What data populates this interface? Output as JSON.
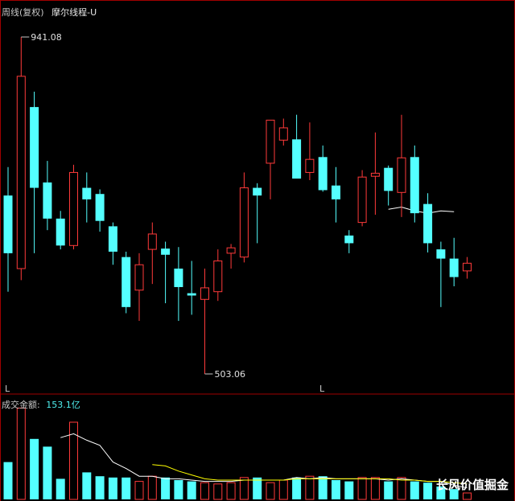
{
  "header": {
    "period": "周线(复权)",
    "indicator": "摩尔线程-U"
  },
  "volume_header": {
    "label": "成交金额:",
    "value": "153.1亿"
  },
  "markers": {
    "left_l": "L",
    "right_l": "L"
  },
  "watermark": "长风价值掘金",
  "colors": {
    "up": "#ff3a3a",
    "down": "#54ffff",
    "ma_volume_1": "#ffffff",
    "ma_volume_2": "#ffff00",
    "price_ma": "#ffffff",
    "frame": "#a00000"
  },
  "chart_data": {
    "type": "candlestick",
    "price_axis_visible": false,
    "annotations": {
      "high": "941.08",
      "low": "503.06"
    },
    "candles": [
      {
        "o": 735,
        "h": 772,
        "l": 610,
        "c": 660
      },
      {
        "o": 640,
        "h": 941.08,
        "l": 625,
        "c": 890
      },
      {
        "o": 850,
        "h": 870,
        "l": 660,
        "c": 745
      },
      {
        "o": 752,
        "h": 780,
        "l": 690,
        "c": 705
      },
      {
        "o": 705,
        "h": 715,
        "l": 665,
        "c": 670
      },
      {
        "o": 670,
        "h": 775,
        "l": 665,
        "c": 765
      },
      {
        "o": 745,
        "h": 765,
        "l": 700,
        "c": 730
      },
      {
        "o": 737,
        "h": 743,
        "l": 688,
        "c": 702
      },
      {
        "o": 695,
        "h": 700,
        "l": 645,
        "c": 662
      },
      {
        "o": 655,
        "h": 662,
        "l": 582,
        "c": 590
      },
      {
        "o": 612,
        "h": 660,
        "l": 572,
        "c": 645
      },
      {
        "o": 665,
        "h": 700,
        "l": 620,
        "c": 685
      },
      {
        "o": 666,
        "h": 675,
        "l": 595,
        "c": 658
      },
      {
        "o": 640,
        "h": 668,
        "l": 572,
        "c": 616
      },
      {
        "o": 608,
        "h": 650,
        "l": 580,
        "c": 605
      },
      {
        "o": 600,
        "h": 640,
        "l": 503.06,
        "c": 615
      },
      {
        "o": 610,
        "h": 665,
        "l": 598,
        "c": 650
      },
      {
        "o": 660,
        "h": 672,
        "l": 640,
        "c": 667
      },
      {
        "o": 655,
        "h": 765,
        "l": 648,
        "c": 745
      },
      {
        "o": 745,
        "h": 751,
        "l": 673,
        "c": 735
      },
      {
        "o": 777,
        "h": 824,
        "l": 730,
        "c": 833
      },
      {
        "o": 807,
        "h": 835,
        "l": 800,
        "c": 823
      },
      {
        "o": 808,
        "h": 840,
        "l": 780,
        "c": 757
      },
      {
        "o": 765,
        "h": 830,
        "l": 755,
        "c": 782
      },
      {
        "o": 785,
        "h": 800,
        "l": 740,
        "c": 742
      },
      {
        "o": 748,
        "h": 772,
        "l": 700,
        "c": 730
      },
      {
        "o": 683,
        "h": 690,
        "l": 660,
        "c": 673
      },
      {
        "o": 700,
        "h": 768,
        "l": 695,
        "c": 759
      },
      {
        "o": 760,
        "h": 817,
        "l": 710,
        "c": 764
      },
      {
        "o": 771,
        "h": 774,
        "l": 722,
        "c": 741
      },
      {
        "o": 739,
        "h": 840,
        "l": 707,
        "c": 784
      },
      {
        "o": 785,
        "h": 800,
        "l": 700,
        "c": 712
      },
      {
        "o": 724,
        "h": 738,
        "l": 661,
        "c": 673
      },
      {
        "o": 665,
        "h": 675,
        "l": 590,
        "c": 653
      },
      {
        "o": 653,
        "h": 680,
        "l": 617,
        "c": 629
      },
      {
        "o": 637,
        "h": 655,
        "l": 627,
        "c": 647
      }
    ],
    "price_ma": [
      null,
      null,
      null,
      null,
      null,
      null,
      null,
      null,
      null,
      null,
      null,
      null,
      null,
      null,
      null,
      null,
      null,
      null,
      null,
      null,
      null,
      null,
      null,
      null,
      null,
      null,
      null,
      null,
      null,
      717,
      720,
      715,
      712,
      715,
      714,
      null
    ],
    "volume": [
      29,
      71,
      47,
      41,
      16,
      60,
      21,
      18,
      17,
      17,
      14,
      18,
      17,
      15,
      14,
      13,
      12,
      13,
      17,
      17,
      13,
      15,
      17,
      18,
      18,
      15,
      14,
      17,
      17,
      14,
      17,
      14,
      13,
      10,
      8,
      5
    ],
    "volume_ma1": [
      null,
      null,
      null,
      null,
      48,
      51,
      46,
      42,
      29,
      24,
      18,
      18,
      16,
      16,
      15,
      14,
      14,
      14,
      15,
      15,
      15,
      15,
      17,
      16,
      17,
      16,
      16,
      16,
      16,
      15,
      16,
      15,
      14,
      14,
      11,
      9
    ],
    "volume_ma2": [
      null,
      null,
      null,
      null,
      null,
      null,
      null,
      null,
      null,
      null,
      null,
      27,
      26,
      22,
      19,
      16,
      15,
      15,
      15,
      15,
      15,
      15,
      16,
      16,
      16,
      16,
      16,
      16,
      16,
      16,
      15,
      15,
      14,
      14,
      13,
      12
    ]
  }
}
